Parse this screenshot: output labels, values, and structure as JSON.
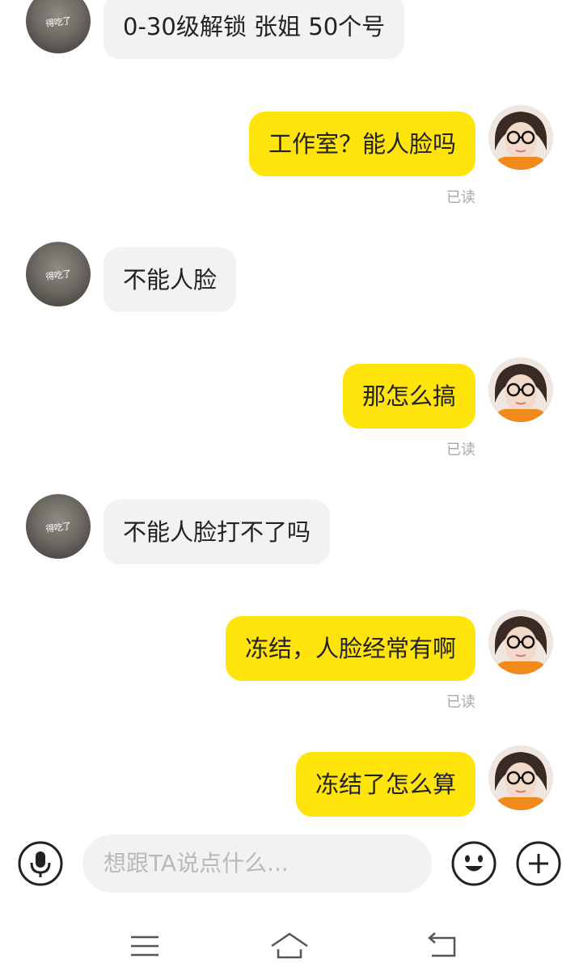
{
  "chat": {
    "messages": [
      {
        "side": "left",
        "text": "0-30级解锁 张姐 50个号"
      },
      {
        "side": "right",
        "text": "工作室？能人脸吗",
        "status": "已读"
      },
      {
        "side": "left",
        "text": "不能人脸"
      },
      {
        "side": "right",
        "text": "那怎么搞",
        "status": "已读"
      },
      {
        "side": "left",
        "text": "不能人脸打不了吗"
      },
      {
        "side": "right",
        "text": "冻结，人脸经常有啊",
        "status": "已读"
      },
      {
        "side": "right",
        "text": "冻结了怎么算"
      }
    ],
    "contact_avatar_caption": "得吃了"
  },
  "composer": {
    "placeholder": "想跟TA说点什么..."
  },
  "icons": {
    "voice": "microphone-icon",
    "emoji": "smiley-icon",
    "more": "plus-icon",
    "nav_menu": "menu-icon",
    "nav_home": "home-icon",
    "nav_back": "back-icon"
  },
  "colors": {
    "my_bubble": "#ffe40b",
    "their_bubble": "#f2f2f4",
    "read_status": "#a8a8a8"
  }
}
